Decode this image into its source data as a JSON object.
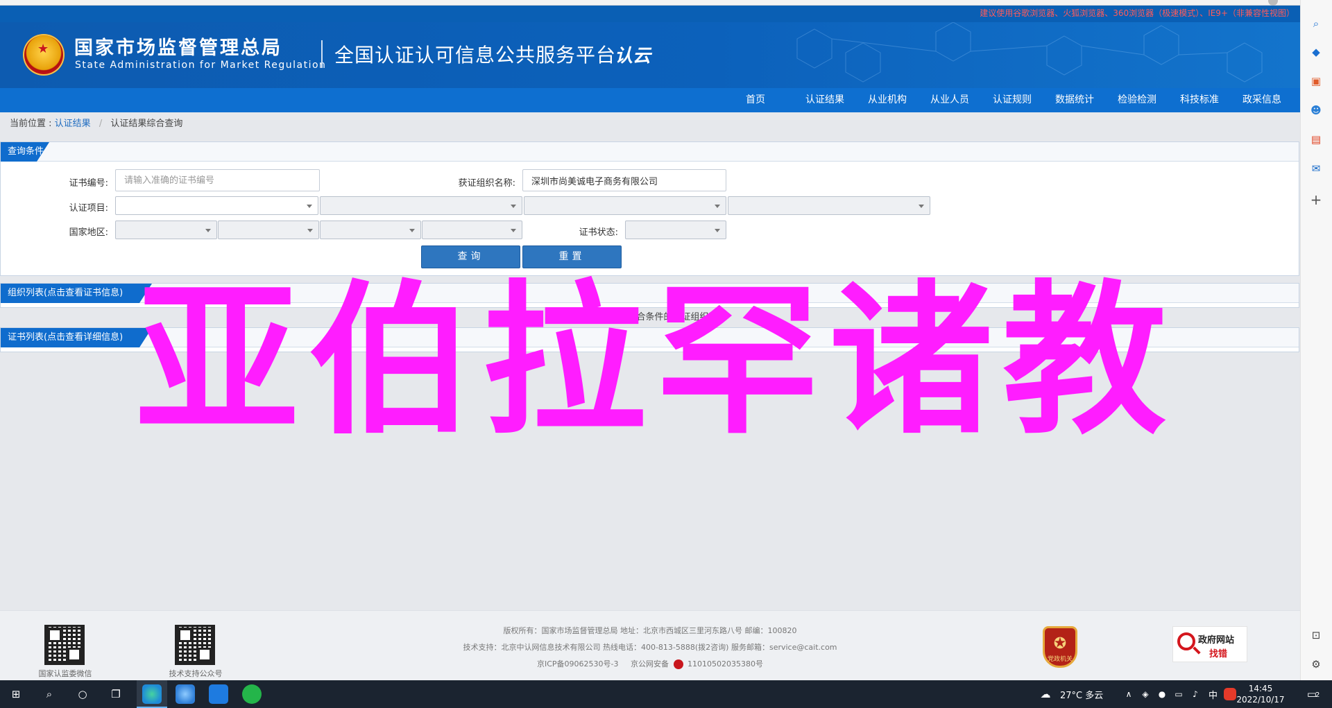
{
  "browser_notice": "建议使用谷歌浏览器、火狐浏览器、360浏览器（极速模式）、IE9+（非兼容性视图）",
  "header": {
    "org_cn": "国家市场监督管理总局",
    "org_en": "State Administration  for  Market Regulation",
    "platform": "全国认证认可信息公共服务平台",
    "logo_text": "认云"
  },
  "nav": [
    "首页",
    "认证结果",
    "从业机构",
    "从业人员",
    "认证规则",
    "数据统计",
    "检验检测",
    "科技标准",
    "政采信息"
  ],
  "breadcrumb": {
    "label": "当前位置 :",
    "link": "认证结果",
    "sep": "/",
    "current": "认证结果综合查询"
  },
  "query_panel": {
    "title": "查询条件",
    "cert_no_label": "证书编号:",
    "cert_no_placeholder": "请输入准确的证书编号",
    "org_name_label": "获证组织名称:",
    "org_name_value": "深圳市尚美诚电子商务有限公司",
    "cert_item_label": "认证项目:",
    "region_label": "国家地区:",
    "status_label": "证书状态:",
    "search_button": "查询",
    "reset_button": "重置"
  },
  "org_panel": {
    "title": "组织列表(点击查看证书信息)",
    "empty_msg": "未查询到符合条件的获证组织"
  },
  "cert_panel": {
    "title": "证书列表(点击查看详细信息)"
  },
  "watermark": "亚伯拉罕诸教",
  "footer": {
    "qr1_caption": "国家认监委微信",
    "qr2_caption": "技术支持公众号",
    "line1": "版权所有：国家市场监督管理总局    地址：北京市西城区三里河东路八号    邮编：100820",
    "line2": "技术支持：北京中认网信息技术有限公司    热线电话：400-813-5888(拨2咨询)    服务邮箱：service@cait.com",
    "icp": "京ICP备09062530号-3",
    "police_label": "京公网安备",
    "police_no": "11010502035380号",
    "party_badge": "党政机关",
    "gov_error_t1": "政府网站",
    "gov_error_t2": "找错"
  },
  "taskbar": {
    "weather": "27°C  多云",
    "ime": "中",
    "time": "14:45",
    "date": "2022/10/17",
    "notifications": "2"
  }
}
